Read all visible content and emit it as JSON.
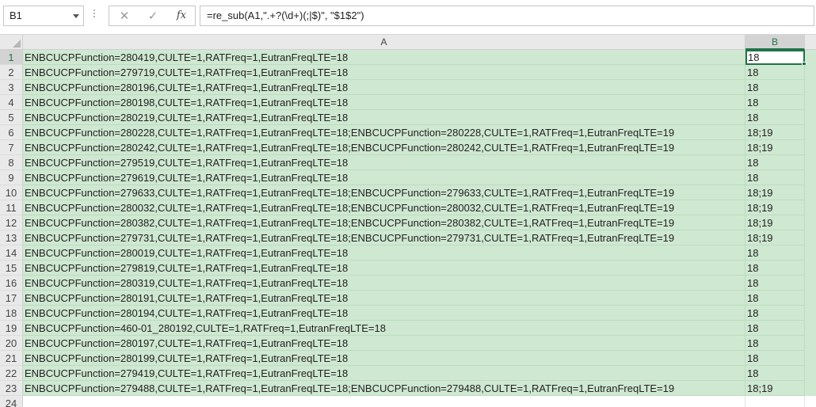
{
  "name_box": {
    "value": "B1"
  },
  "formula_bar": {
    "cancel_glyph": "✕",
    "enter_glyph": "✓",
    "fx_label": "fx",
    "formula": "=re_sub(A1,\".+?(\\d+)(;|$)\", \"$1$2\")"
  },
  "columns": [
    "A",
    "B"
  ],
  "selected_cell": "B1",
  "colors": {
    "fill": "#cfe8d1",
    "accent": "#217346"
  },
  "rows": [
    {
      "num": "1",
      "a": "ENBCUCPFunction=280419,CULTE=1,RATFreq=1,EutranFreqLTE=18",
      "b": "18"
    },
    {
      "num": "2",
      "a": "ENBCUCPFunction=279719,CULTE=1,RATFreq=1,EutranFreqLTE=18",
      "b": "18"
    },
    {
      "num": "3",
      "a": "ENBCUCPFunction=280196,CULTE=1,RATFreq=1,EutranFreqLTE=18",
      "b": "18"
    },
    {
      "num": "4",
      "a": "ENBCUCPFunction=280198,CULTE=1,RATFreq=1,EutranFreqLTE=18",
      "b": "18"
    },
    {
      "num": "5",
      "a": "ENBCUCPFunction=280219,CULTE=1,RATFreq=1,EutranFreqLTE=18",
      "b": "18"
    },
    {
      "num": "6",
      "a": "ENBCUCPFunction=280228,CULTE=1,RATFreq=1,EutranFreqLTE=18;ENBCUCPFunction=280228,CULTE=1,RATFreq=1,EutranFreqLTE=19",
      "b": "18;19"
    },
    {
      "num": "7",
      "a": "ENBCUCPFunction=280242,CULTE=1,RATFreq=1,EutranFreqLTE=18;ENBCUCPFunction=280242,CULTE=1,RATFreq=1,EutranFreqLTE=19",
      "b": "18;19"
    },
    {
      "num": "8",
      "a": "ENBCUCPFunction=279519,CULTE=1,RATFreq=1,EutranFreqLTE=18",
      "b": "18"
    },
    {
      "num": "9",
      "a": "ENBCUCPFunction=279619,CULTE=1,RATFreq=1,EutranFreqLTE=18",
      "b": "18"
    },
    {
      "num": "10",
      "a": "ENBCUCPFunction=279633,CULTE=1,RATFreq=1,EutranFreqLTE=18;ENBCUCPFunction=279633,CULTE=1,RATFreq=1,EutranFreqLTE=19",
      "b": "18;19"
    },
    {
      "num": "11",
      "a": "ENBCUCPFunction=280032,CULTE=1,RATFreq=1,EutranFreqLTE=18;ENBCUCPFunction=280032,CULTE=1,RATFreq=1,EutranFreqLTE=19",
      "b": "18;19"
    },
    {
      "num": "12",
      "a": "ENBCUCPFunction=280382,CULTE=1,RATFreq=1,EutranFreqLTE=18;ENBCUCPFunction=280382,CULTE=1,RATFreq=1,EutranFreqLTE=19",
      "b": "18;19"
    },
    {
      "num": "13",
      "a": "ENBCUCPFunction=279731,CULTE=1,RATFreq=1,EutranFreqLTE=18;ENBCUCPFunction=279731,CULTE=1,RATFreq=1,EutranFreqLTE=19",
      "b": "18;19"
    },
    {
      "num": "14",
      "a": "ENBCUCPFunction=280019,CULTE=1,RATFreq=1,EutranFreqLTE=18",
      "b": "18"
    },
    {
      "num": "15",
      "a": "ENBCUCPFunction=279819,CULTE=1,RATFreq=1,EutranFreqLTE=18",
      "b": "18"
    },
    {
      "num": "16",
      "a": "ENBCUCPFunction=280319,CULTE=1,RATFreq=1,EutranFreqLTE=18",
      "b": "18"
    },
    {
      "num": "17",
      "a": "ENBCUCPFunction=280191,CULTE=1,RATFreq=1,EutranFreqLTE=18",
      "b": "18"
    },
    {
      "num": "18",
      "a": "ENBCUCPFunction=280194,CULTE=1,RATFreq=1,EutranFreqLTE=18",
      "b": "18"
    },
    {
      "num": "19",
      "a": "ENBCUCPFunction=460-01_280192,CULTE=1,RATFreq=1,EutranFreqLTE=18",
      "b": "18"
    },
    {
      "num": "20",
      "a": "ENBCUCPFunction=280197,CULTE=1,RATFreq=1,EutranFreqLTE=18",
      "b": "18"
    },
    {
      "num": "21",
      "a": "ENBCUCPFunction=280199,CULTE=1,RATFreq=1,EutranFreqLTE=18",
      "b": "18"
    },
    {
      "num": "22",
      "a": "ENBCUCPFunction=279419,CULTE=1,RATFreq=1,EutranFreqLTE=18",
      "b": "18"
    },
    {
      "num": "23",
      "a": "ENBCUCPFunction=279488,CULTE=1,RATFreq=1,EutranFreqLTE=18;ENBCUCPFunction=279488,CULTE=1,RATFreq=1,EutranFreqLTE=19",
      "b": "18;19"
    },
    {
      "num": "24",
      "a": "",
      "b": ""
    }
  ]
}
